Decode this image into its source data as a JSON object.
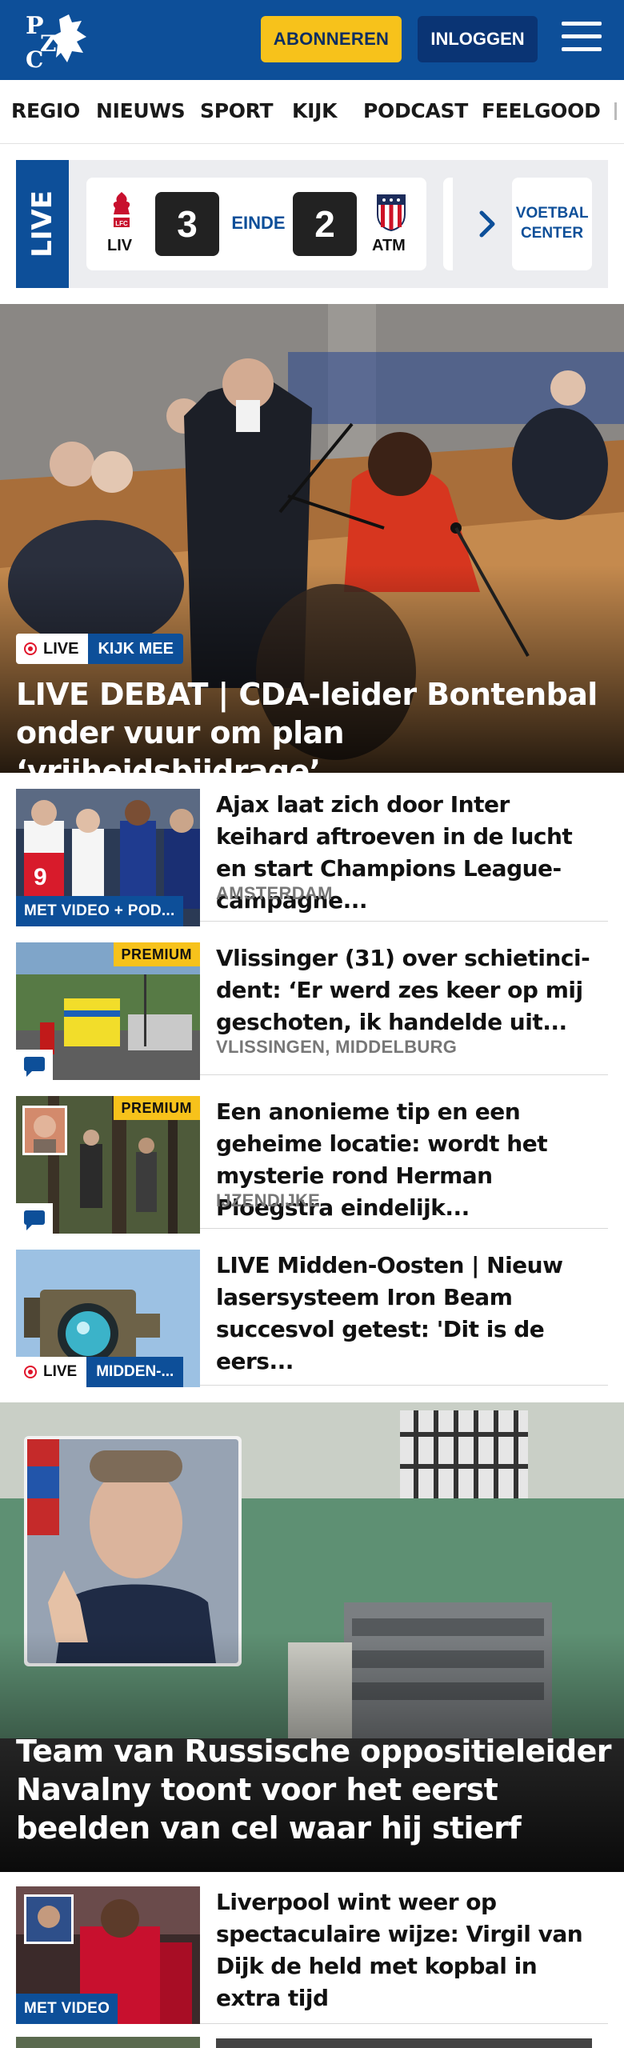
{
  "header": {
    "subscribe_label": "ABONNEREN",
    "login_label": "INLOGGEN"
  },
  "nav": {
    "items": [
      "REGIO",
      "NIEUWS",
      "SPORT",
      "KIJK",
      "PODCAST",
      "FEELGOOD"
    ]
  },
  "live_scores": {
    "tab_label": "LIVE",
    "match": {
      "home": "LIV",
      "away": "ATM",
      "home_score": "3",
      "away_score": "2",
      "status": "EINDE"
    },
    "voetbal_center_label": "VOETBAL CENTER"
  },
  "hero": {
    "live_label": "LIVE",
    "badge_label": "KIJK MEE",
    "title": "LIVE DEBAT | CDA-leider Bontenbal onder vuur om plan ‘vrijheidsbijdrage’"
  },
  "articles": [
    {
      "title": "Ajax laat zich door Inter keihard aftroeven in de lucht en start Champions League-campagne...",
      "location": "AMSTERDAM",
      "label": "MET VIDEO + POD..."
    },
    {
      "title": "Vlissinger (31) over schietinci­dent: ‘Er werd zes keer op mij geschoten, ik handelde uit...",
      "location": "VLISSINGEN, MIDDELBURG",
      "premium": "PREMIUM"
    },
    {
      "title": "Een anonieme tip en een geheime locatie: wordt het mysterie rond Herman Ploegstra eindelijk...",
      "location": "IJZENDIJKE",
      "premium": "PREMIUM"
    },
    {
      "title": "LIVE Midden-Oosten | Nieuw lasersysteem Iron Beam succesvol getest: 'Dit is de eers...",
      "live_label": "LIVE",
      "badge_label": "MIDDEN-..."
    }
  ],
  "hero2": {
    "title": "Team van Russische oppositieleider Navalny toont voor het eerst beelden van cel waar hij stierf"
  },
  "article5": {
    "title": "Liverpool wint weer op spectacu­laire wijze: Virgil van Dijk de held met kopbal in extra tijd",
    "label": "MET VIDEO"
  },
  "colors": {
    "brand_blue": "#0d4f99",
    "subscribe_yellow": "#f7c21b",
    "live_red": "#e0142a"
  }
}
